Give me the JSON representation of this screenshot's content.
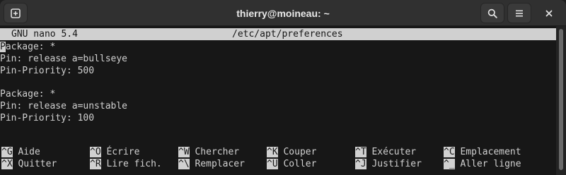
{
  "window": {
    "title": "thierry@moineau: ~"
  },
  "headerbar": {
    "new_tab_icon": "new-tab-icon",
    "search_icon": "search-icon",
    "menu_icon": "hamburger-menu-icon",
    "close_icon": "close-icon"
  },
  "nano": {
    "version": "GNU nano 5.4",
    "filename": "/etc/apt/preferences",
    "cursor_char": "P",
    "lines": [
      "ackage: *",
      "Pin: release a=bullseye",
      "Pin-Priority: 500",
      "",
      "Package: *",
      "Pin: release a=unstable",
      "Pin-Priority: 100"
    ],
    "shortcuts_row1": [
      {
        "key": "^G",
        "label": "Aide"
      },
      {
        "key": "^O",
        "label": "Écrire"
      },
      {
        "key": "^W",
        "label": "Chercher"
      },
      {
        "key": "^K",
        "label": "Couper"
      },
      {
        "key": "^T",
        "label": "Exécuter"
      },
      {
        "key": "^C",
        "label": "Emplacement"
      }
    ],
    "shortcuts_row2": [
      {
        "key": "^X",
        "label": "Quitter"
      },
      {
        "key": "^R",
        "label": "Lire fich."
      },
      {
        "key": "^\\",
        "label": "Remplacer"
      },
      {
        "key": "^U",
        "label": "Coller"
      },
      {
        "key": "^J",
        "label": "Justifier"
      },
      {
        "key": "^_",
        "label": "Aller ligne"
      }
    ]
  },
  "colors": {
    "background": "#171717",
    "text": "#d0d0d0",
    "headerbar": "#303030"
  }
}
